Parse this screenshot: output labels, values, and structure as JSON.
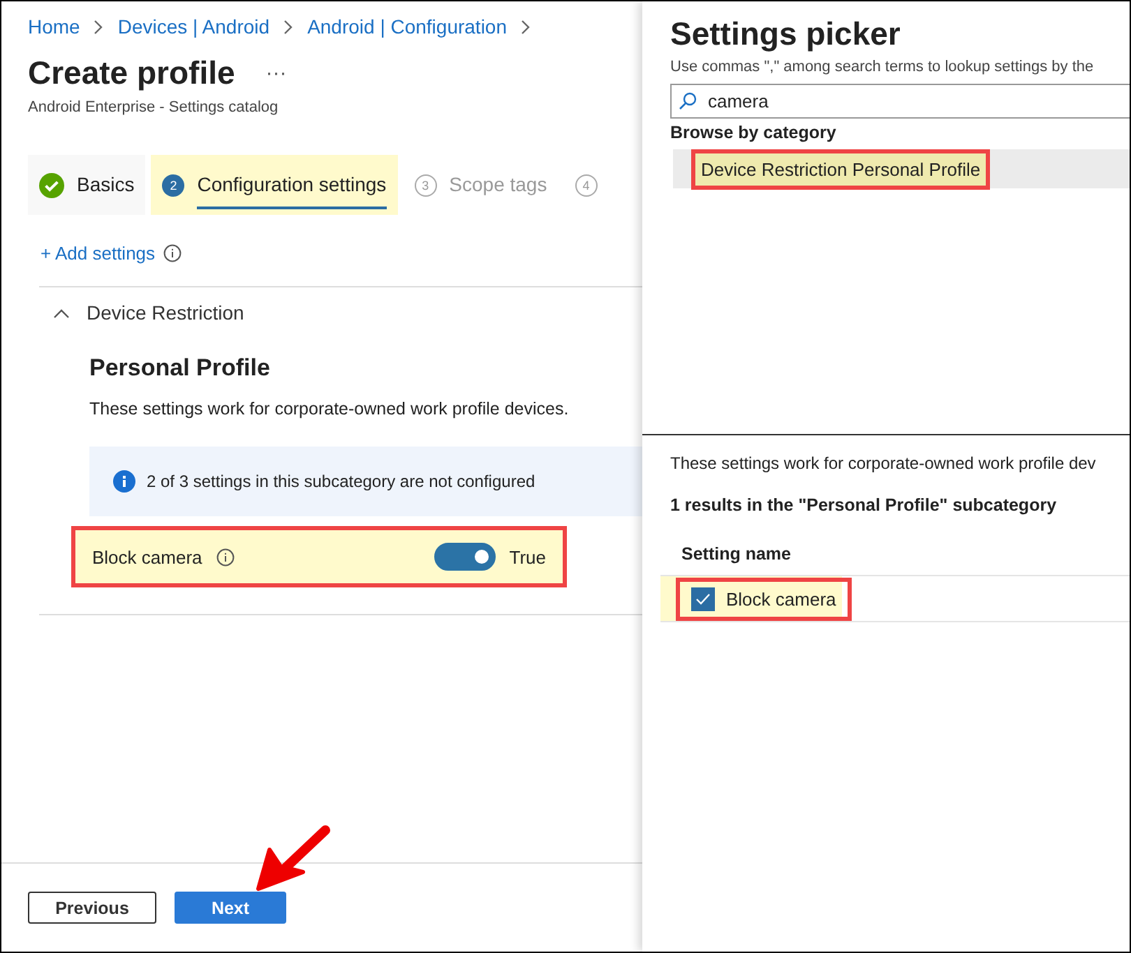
{
  "breadcrumb": [
    {
      "label": "Home"
    },
    {
      "label": "Devices | Android"
    },
    {
      "label": "Android | Configuration"
    }
  ],
  "page": {
    "title": "Create profile",
    "more": "···",
    "subtitle": "Android Enterprise - Settings catalog"
  },
  "steps": [
    {
      "label": "Basics",
      "kind": "done",
      "selected": false,
      "highlighted": false
    },
    {
      "number": "2",
      "label": "Configuration settings",
      "kind": "current",
      "selected": true,
      "highlighted": true
    },
    {
      "number": "3",
      "label": "Scope tags",
      "kind": "pending",
      "selected": false,
      "highlighted": false
    },
    {
      "number": "4",
      "kind": "pending",
      "selected": false,
      "highlighted": false
    }
  ],
  "add_settings": "+ Add settings",
  "section": {
    "title": "Device Restriction",
    "expanded": true,
    "subcategory": "Personal Profile",
    "description": "These settings work for corporate-owned work profile devices.",
    "info": "2 of 3 settings in this subcategory are not configured",
    "settings": [
      {
        "label": "Block camera",
        "on": true,
        "value": "True",
        "highlighted": true,
        "annotated": true
      }
    ]
  },
  "footer": {
    "buttons": [
      {
        "label": "Previous",
        "kind": "secondary"
      },
      {
        "label": "Next",
        "kind": "primary"
      }
    ],
    "arrow_annotation": true
  },
  "settings_picker": {
    "title": "Settings picker",
    "hint": "Use commas \",\" among search terms to lookup settings by the",
    "search": {
      "value": "camera"
    },
    "browse_label": "Browse by category",
    "categories": [
      {
        "label": "Device Restriction Personal Profile",
        "selected": true,
        "highlighted": true,
        "annotated": true
      }
    ],
    "description": "These settings work for corporate-owned work profile dev",
    "results": "1 results in the \"Personal Profile\" subcategory",
    "column": "Setting name",
    "rows": [
      {
        "label": "Block camera",
        "checked": true,
        "highlighted": true,
        "annotated": true
      }
    ]
  }
}
